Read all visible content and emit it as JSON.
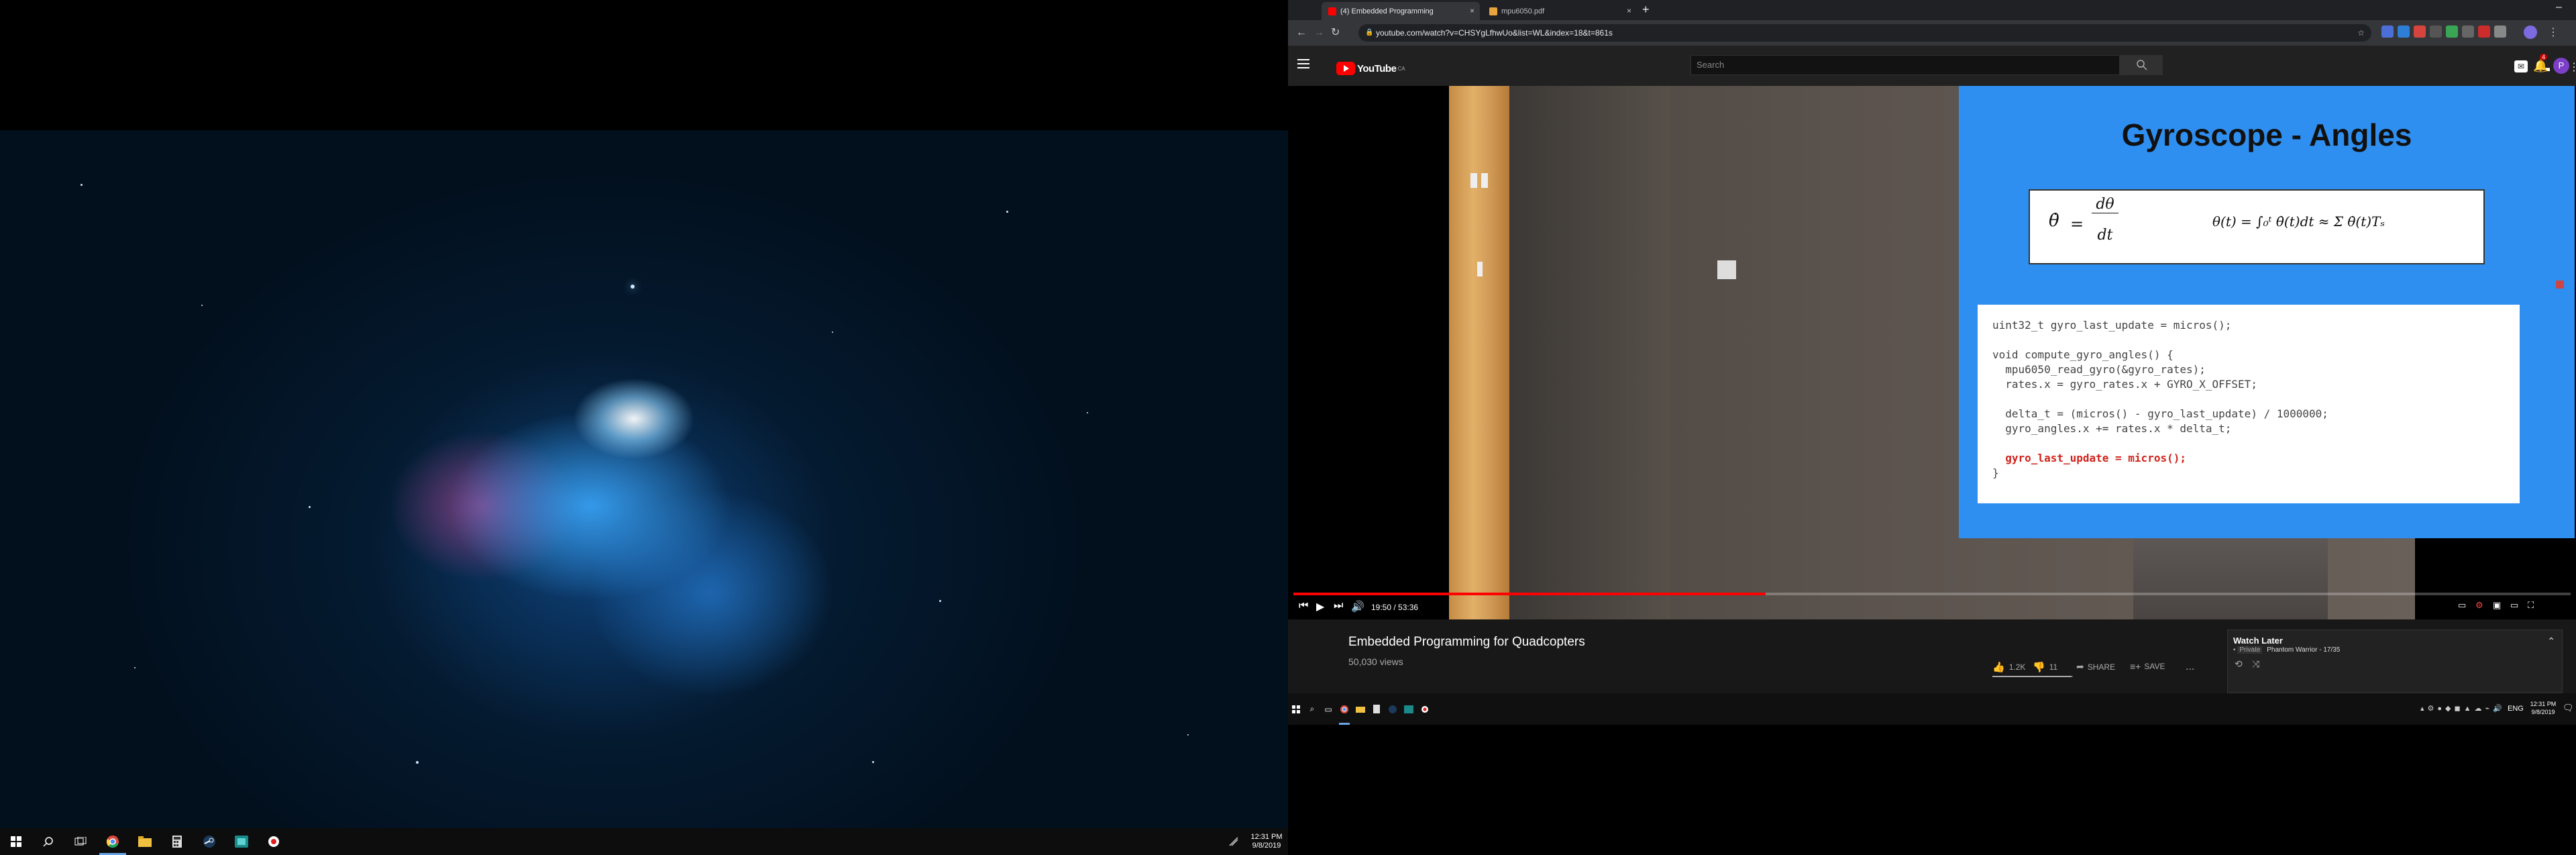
{
  "left_taskbar": {
    "icons": [
      "windows-start-icon",
      "search-icon",
      "task-view-icon",
      "chrome-icon",
      "file-explorer-icon",
      "calculator-icon",
      "steam-icon",
      "app-icon",
      "record-icon"
    ],
    "time": "12:31 PM",
    "date": "9/8/2019"
  },
  "browser": {
    "tabs": [
      {
        "title": "(4) Embedded Programming",
        "active": true
      },
      {
        "title": "mpu6050.pdf",
        "active": false
      }
    ],
    "new_tab": "+",
    "window_minimize": "–",
    "url": "youtube.com/watch?v=CHSYgLfhwUo&list=WL&index=18&t=861s"
  },
  "youtube": {
    "logo_text": "YouTube",
    "logo_sup": "CA",
    "search_placeholder": "Search",
    "notification_count": "4",
    "avatar_letter": "P",
    "slide": {
      "title": "Gyroscope - Angles",
      "eq_left_lhs": "θ̇",
      "eq_left_num": "dθ",
      "eq_left_den": "dt",
      "eq_right": "θ(t) = ∫₀ᵗ θ̇(t)dt ≈ Σ θ̇(t)Tₛ",
      "code": [
        "uint32_t gyro_last_update = micros();",
        "",
        "void compute_gyro_angles() {",
        "  mpu6050_read_gyro(&gyro_rates);",
        "  rates.x = gyro_rates.x + GYRO_X_OFFSET;",
        "",
        "  delta_t = (micros() - gyro_last_update) / 1000000;",
        "  gyro_angles.x += rates.x * delta_t;",
        ""
      ],
      "code_highlight": "  gyro_last_update = micros();",
      "code_end": "}"
    },
    "player": {
      "time": "19:50 / 53:36",
      "progress": 0.37
    },
    "video": {
      "title": "Embedded Programming for Quadcopters",
      "views": "50,030 views",
      "likes": "1.2K",
      "dislikes": "11",
      "share": "SHARE",
      "save": "SAVE",
      "more": "..."
    },
    "playlist": {
      "title": "Watch Later",
      "privacy": "Private",
      "owner_position": "Phantom Warrior - 17/35"
    }
  },
  "right_taskbar": {
    "lang": "ENG",
    "time": "12:31 PM",
    "date": "9/8/2019"
  },
  "colors": {
    "youtube_red": "#ff0000",
    "slide_blue": "#2f8ff0",
    "taskbar": "#101010"
  }
}
